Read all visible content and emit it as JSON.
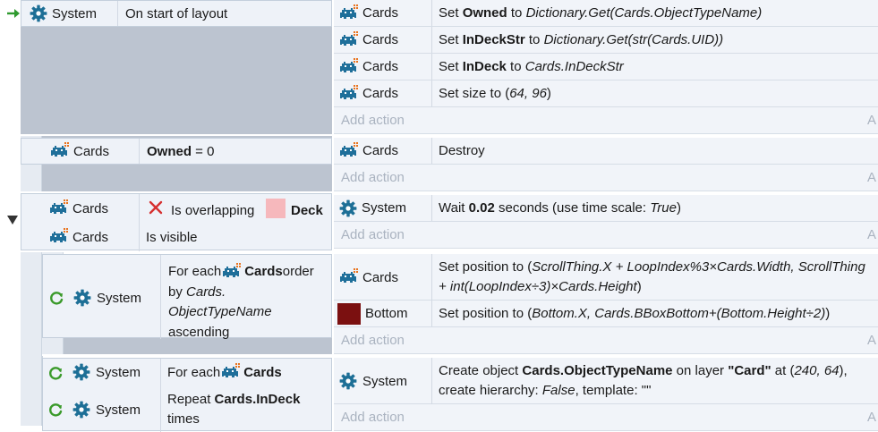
{
  "event1": {
    "condition": {
      "object": "System",
      "text": "On start of layout"
    },
    "actions": [
      {
        "object": "Cards",
        "verb": "Set ",
        "bold": "Owned",
        "mid": " to ",
        "italic": "Dictionary.Get(Cards.ObjectTypeName)"
      },
      {
        "object": "Cards",
        "verb": "Set ",
        "bold": "InDeckStr",
        "mid": " to ",
        "italic": "Dictionary.Get(str(Cards.UID))"
      },
      {
        "object": "Cards",
        "verb": "Set ",
        "bold": "InDeck",
        "mid": " to ",
        "italic": "Cards.InDeckStr"
      },
      {
        "object": "Cards",
        "verb": "Set size to (",
        "italic": "64, 96",
        "end": ")"
      }
    ],
    "add_action": "Add action"
  },
  "event2": {
    "condition": {
      "object": "Cards",
      "bold": "Owned",
      "rest": " = 0"
    },
    "actions": [
      {
        "object": "Cards",
        "text": "Destroy"
      }
    ],
    "add_action": "Add action"
  },
  "event3": {
    "conditions": [
      {
        "object": "Cards",
        "text": "Is overlapping",
        "target": "Deck",
        "target_color": "#f6b8bc"
      },
      {
        "object": "Cards",
        "text": "Is visible"
      }
    ],
    "actions": [
      {
        "object": "System",
        "pre": "Wait ",
        "bold": "0.02",
        "mid": " seconds (use time scale: ",
        "italic": "True",
        "end": ")"
      }
    ],
    "add_action": "Add action"
  },
  "event4": {
    "condition": {
      "object": "System",
      "line1_pre": "For each ",
      "line1_obj": "Cards",
      "line1_post": " order",
      "line2_pre": "by ",
      "line2_italic": "Cards.",
      "line3_italic": "ObjectTypeName",
      "line4": "ascending"
    },
    "actions": [
      {
        "object": "Cards",
        "line1_pre": "Set position to (",
        "line1_italic": "ScrollThing.X + LoopIndex%3×Cards.Width, ScrollThing",
        "line2_italic": "+ int(LoopIndex÷3)×Cards.Height",
        "line2_end": ")"
      },
      {
        "object": "Bottom",
        "object_color": "#7b1010",
        "pre": "Set position to (",
        "italic": "Bottom.X, Cards.BBoxBottom+(Bottom.Height÷2)",
        "end": ")"
      }
    ],
    "add_action": "Add action"
  },
  "event5": {
    "conditions": [
      {
        "object": "System",
        "pre": "For each ",
        "obj": "Cards"
      },
      {
        "object": "System",
        "pre": "Repeat ",
        "bold": "Cards.InDeck",
        "line2": "times"
      }
    ],
    "actions": [
      {
        "object": "System",
        "line1_pre": "Create object ",
        "line1_bold": "Cards.ObjectTypeName",
        "line1_mid": " on layer ",
        "line1_bold2": "\"Card\"",
        "line1_mid2": " at (",
        "line1_italic": "240, 64",
        "line1_end": "),",
        "line2_pre": "create hierarchy: ",
        "line2_italic": "False",
        "line2_mid": ", template: ",
        "line2_end": "\"\""
      }
    ],
    "add_action": "Add action"
  },
  "edge_letter": "A",
  "colors": {
    "system_gear": "#1d6f96",
    "loop_arrow": "#3a9a2a",
    "start_arrow": "#2f9a2f",
    "cross": "#d63030"
  }
}
